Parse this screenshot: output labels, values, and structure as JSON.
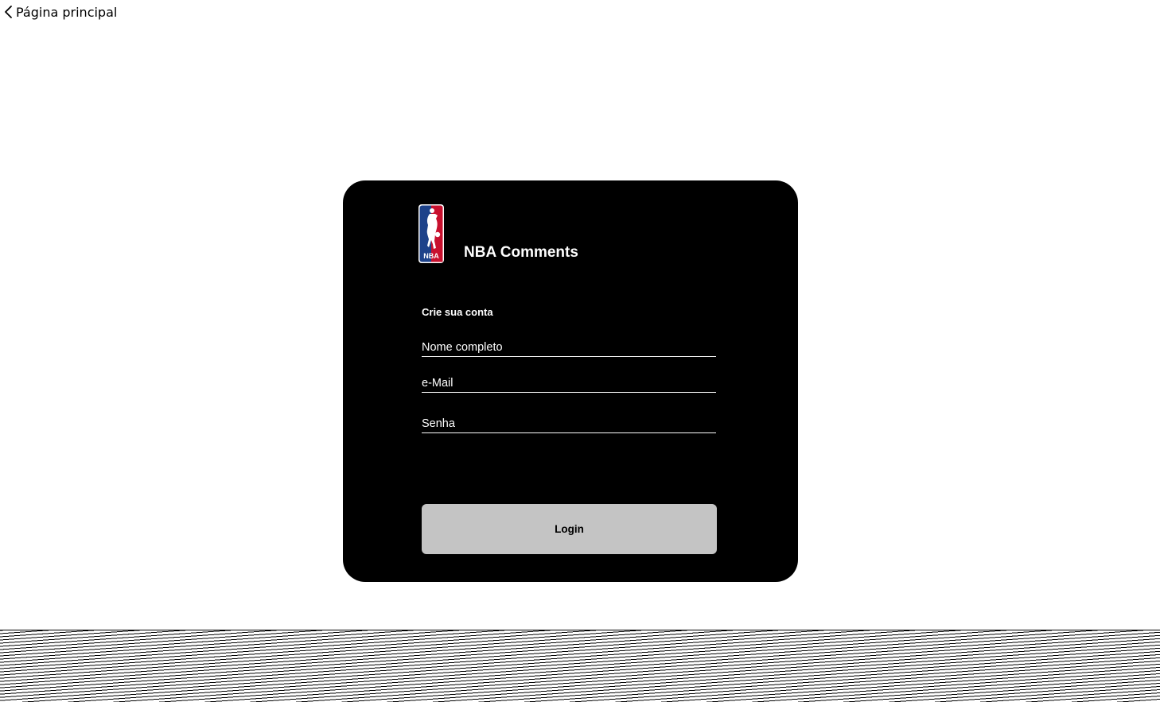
{
  "nav": {
    "back_label": "Página principal",
    "back_icon": "chevron-left-icon"
  },
  "brand": {
    "logo_icon": "nba-logo",
    "title": "NBA Comments",
    "logo_colors": {
      "blue": "#1d428a",
      "red": "#c8102e",
      "white": "#ffffff"
    }
  },
  "form": {
    "title": "Crie sua conta",
    "name_placeholder": "Nome completo",
    "email_placeholder": "e-Mail",
    "password_placeholder": "Senha",
    "submit_label": "Login"
  },
  "colors": {
    "card_background": "#000000",
    "button_background": "#c4c4c4",
    "page_background": "#ffffff"
  }
}
